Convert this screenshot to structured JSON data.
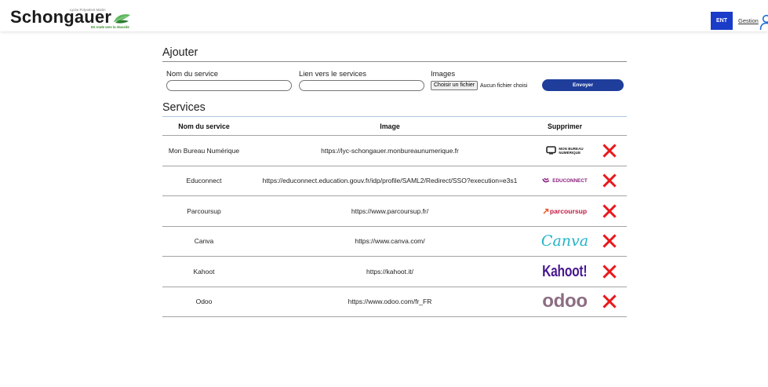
{
  "header": {
    "logo": {
      "top_line": "Lycée Polyvalent Martin",
      "name": "Schongauer",
      "tagline": "En route vers la réussite",
      "icon": "leaf-icon"
    },
    "ent_label": "ENT",
    "gestion_label": "Gestion",
    "user_icon": "user-icon"
  },
  "add_form": {
    "title": "Ajouter",
    "name_label": "Nom du service",
    "link_label": "Lien vers le services",
    "images_label": "Images",
    "file_button_label": "Choisir un fichier",
    "file_status": "Aucun fichier choisi",
    "submit_label": "Envoyer"
  },
  "services": {
    "title": "Services",
    "columns": [
      "Nom du service",
      "Image",
      "Supprimer"
    ],
    "rows": [
      {
        "name": "Mon Bureau Numérique",
        "url": "https://lyc-schongauer.monbureaunumerique.fr",
        "logo": {
          "line1": "MON BUREAU",
          "line2": "NUMÉRIQUE",
          "icon": "monitor-icon"
        },
        "delete_icon": "close-icon"
      },
      {
        "name": "Educonnect",
        "url": "https://educonnect.education.gouv.fr/idp/profile/SAML2/Redirect/SSO?execution=e3s1",
        "logo": {
          "text": "EDUCONNECT",
          "icon": "educonnect-mark-icon"
        },
        "delete_icon": "close-icon"
      },
      {
        "name": "Parcoursup",
        "url": "https://www.parcoursup.fr/",
        "logo": {
          "text": "parcoursup",
          "icon": "arrow-icon"
        },
        "delete_icon": "close-icon"
      },
      {
        "name": "Canva",
        "url": "https://www.canva.com/",
        "logo": {
          "text": "Canva"
        },
        "delete_icon": "close-icon"
      },
      {
        "name": "Kahoot",
        "url": "https://kahoot.it/",
        "logo": {
          "text": "Kahoot!"
        },
        "delete_icon": "close-icon"
      },
      {
        "name": "Odoo",
        "url": "https://www.odoo.com/fr_FR",
        "logo": {
          "text": "odoo"
        },
        "delete_icon": "close-icon"
      }
    ]
  },
  "colors": {
    "accent": "#1f3e9c",
    "ent": "#1a3cc8",
    "delete": "#e8181b",
    "green": "#3a8a2a",
    "educonnect": "#8b1f7e",
    "parcoursup": "#c21a43",
    "canva": "#23b4c6",
    "kahoot": "#46178f",
    "odoo": "#8c6d82",
    "user_icon": "#1d6fd6"
  }
}
